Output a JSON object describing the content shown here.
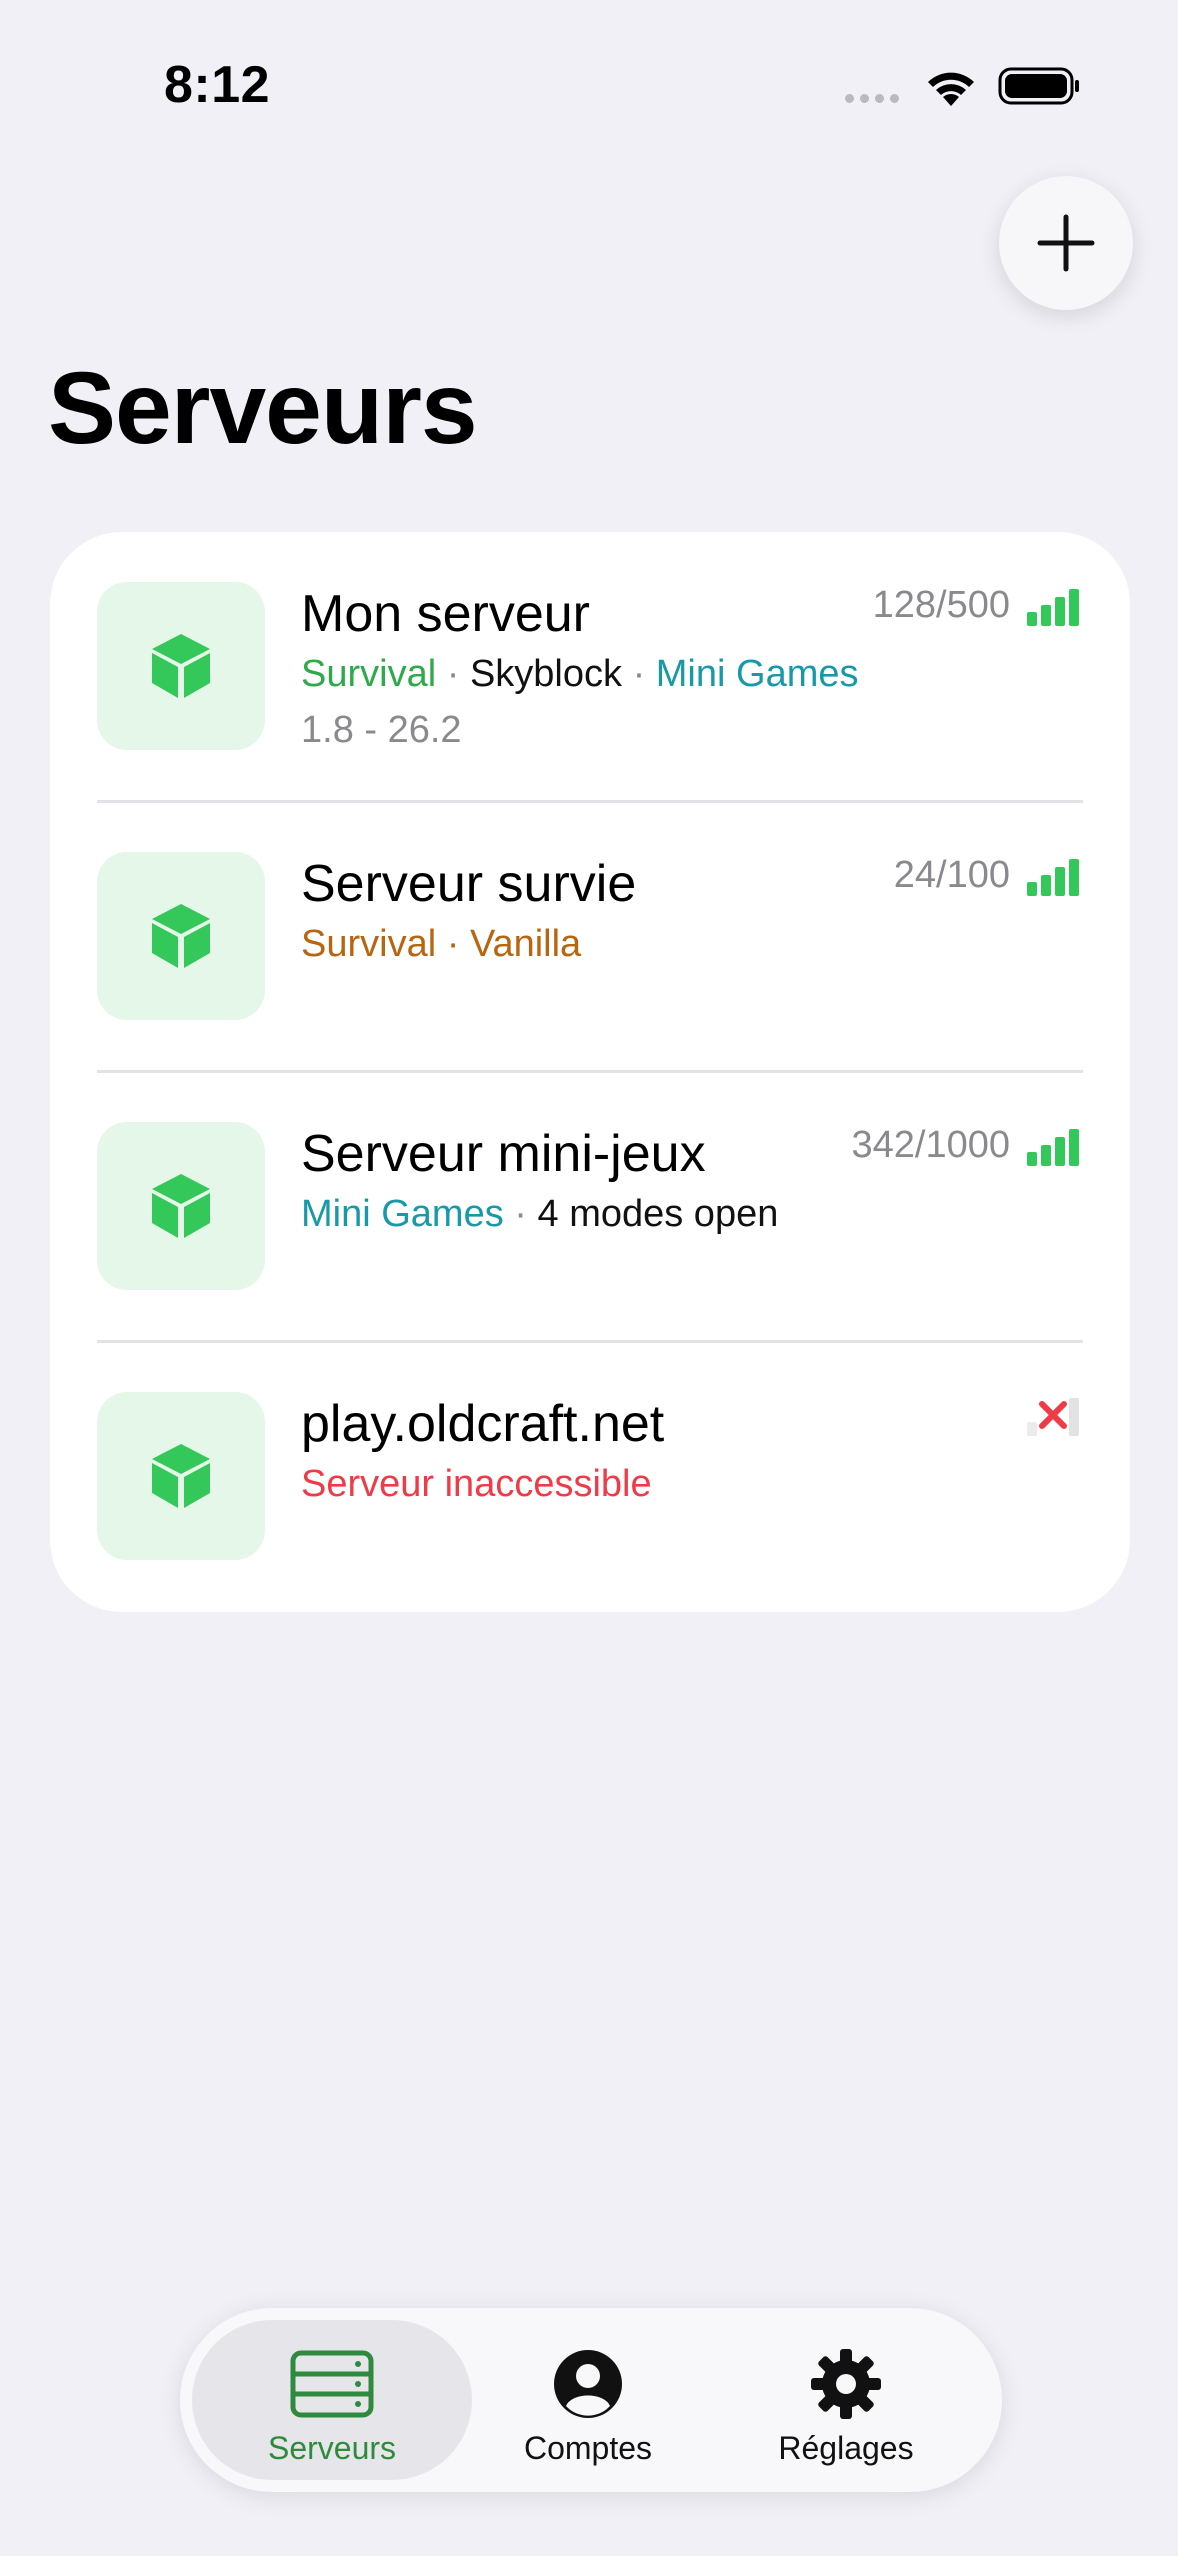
{
  "status_bar": {
    "time": "8:12",
    "wifi_icon": "wifi-icon",
    "battery_icon": "battery-icon"
  },
  "header": {
    "add_icon": "plus-icon",
    "title": "Serveurs"
  },
  "servers": [
    {
      "name": "Mon serveur",
      "players": "128/500",
      "status": "online",
      "tags": [
        {
          "text": "Survival",
          "color": "#2eaa4a"
        },
        {
          "text": "Skyblock",
          "color": "#111111"
        },
        {
          "text": "Mini Games",
          "color": "#1899a8"
        }
      ],
      "version": "1.8 - 26.2"
    },
    {
      "name": "Serveur survie",
      "players": "24/100",
      "status": "online",
      "tags": [
        {
          "text": "Survival",
          "color": "#b8650f"
        },
        {
          "text": "Vanilla",
          "color": "#b8650f"
        }
      ],
      "version": ""
    },
    {
      "name": "Serveur mini-jeux",
      "players": "342/1000",
      "status": "online",
      "tags": [
        {
          "text": "Mini Games",
          "color": "#1899a8"
        },
        {
          "text": "4 modes open",
          "color": "#111111"
        }
      ],
      "version": ""
    },
    {
      "name": "play.oldcraft.net",
      "players": "",
      "status": "offline",
      "tags": [
        {
          "text": "Serveur inaccessible",
          "color": "#ef3b48"
        }
      ],
      "version": ""
    }
  ],
  "tab_bar": {
    "tabs": [
      {
        "label": "Serveurs",
        "icon": "server-rack-icon",
        "selected": true
      },
      {
        "label": "Comptes",
        "icon": "person-circle-icon",
        "selected": false
      },
      {
        "label": "Réglages",
        "icon": "gear-icon",
        "selected": false
      }
    ]
  },
  "colors": {
    "accent": "#34c759",
    "signal_green": "#34c759",
    "error_red": "#ef3b48",
    "icon_bg": "#e5f7e8"
  }
}
